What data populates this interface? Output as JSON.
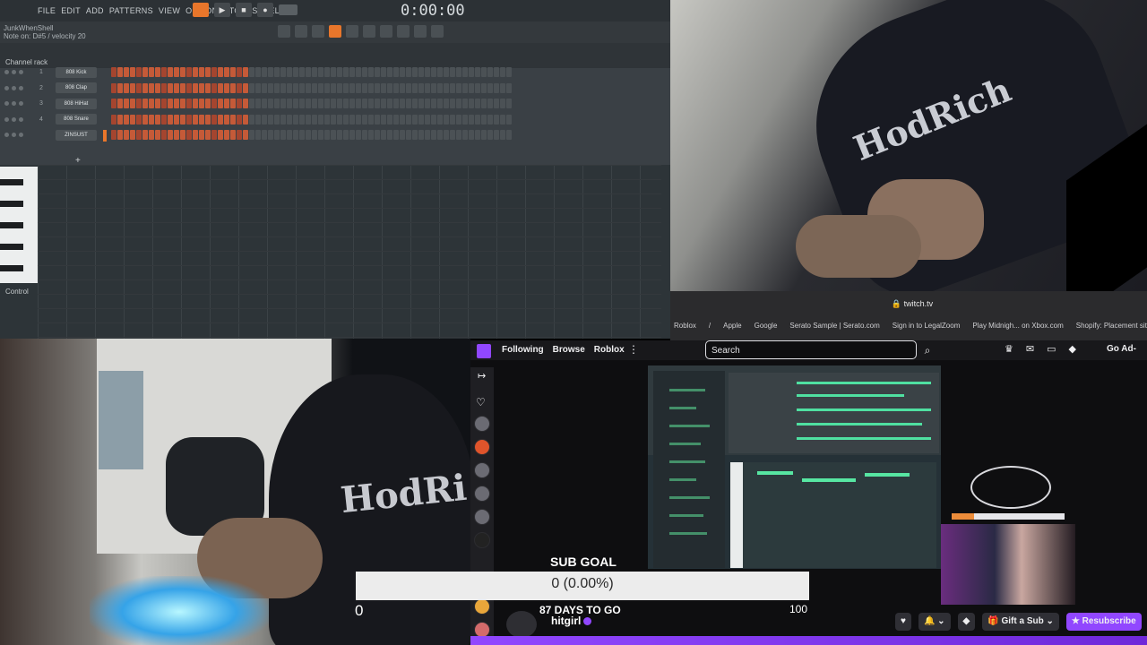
{
  "fl": {
    "menu": [
      "FILE",
      "EDIT",
      "ADD",
      "PATTERNS",
      "VIEW",
      "OPTIONS",
      "TOOLS",
      "HELP"
    ],
    "time": "0:00:00",
    "hint1": "JunkWhenShell",
    "hint2": "Note on: D#5 / velocity 20",
    "rack_title": "Channel rack",
    "channels": [
      {
        "num": "1",
        "name": "808 Kick"
      },
      {
        "num": "2",
        "name": "808 Clap"
      },
      {
        "num": "3",
        "name": "808 HiHat"
      },
      {
        "num": "4",
        "name": "808 Snare"
      },
      {
        "num": "",
        "name": "ZINSUST"
      }
    ],
    "control_label": "Control",
    "accent": "#e8762b"
  },
  "safari": {
    "url": "twitch.tv",
    "favorites": [
      "Roblox",
      "/",
      "Apple",
      "Google",
      "Serato Sample | Serato.com",
      "Sign in to LegalZoom",
      "Play Midnigh... on Xbox.com",
      "Shopify: Placement site"
    ]
  },
  "twitch": {
    "nav": [
      "Following",
      "Browse",
      "Roblox"
    ],
    "search_placeholder": "Search",
    "go_ad_free": "Go Ad-",
    "sub_goal_title": "SUB GOAL",
    "sub_goal_value": "0 (0.00%)",
    "sub_goal_progress": 0,
    "sub_min": "0",
    "sub_max": "100",
    "days_to_go": "87 DAYS TO GO",
    "channel": "hitgirl",
    "gift_sub": "Gift a Sub",
    "resubscribe": "Resubscribe",
    "brand_color": "#9147ff"
  }
}
